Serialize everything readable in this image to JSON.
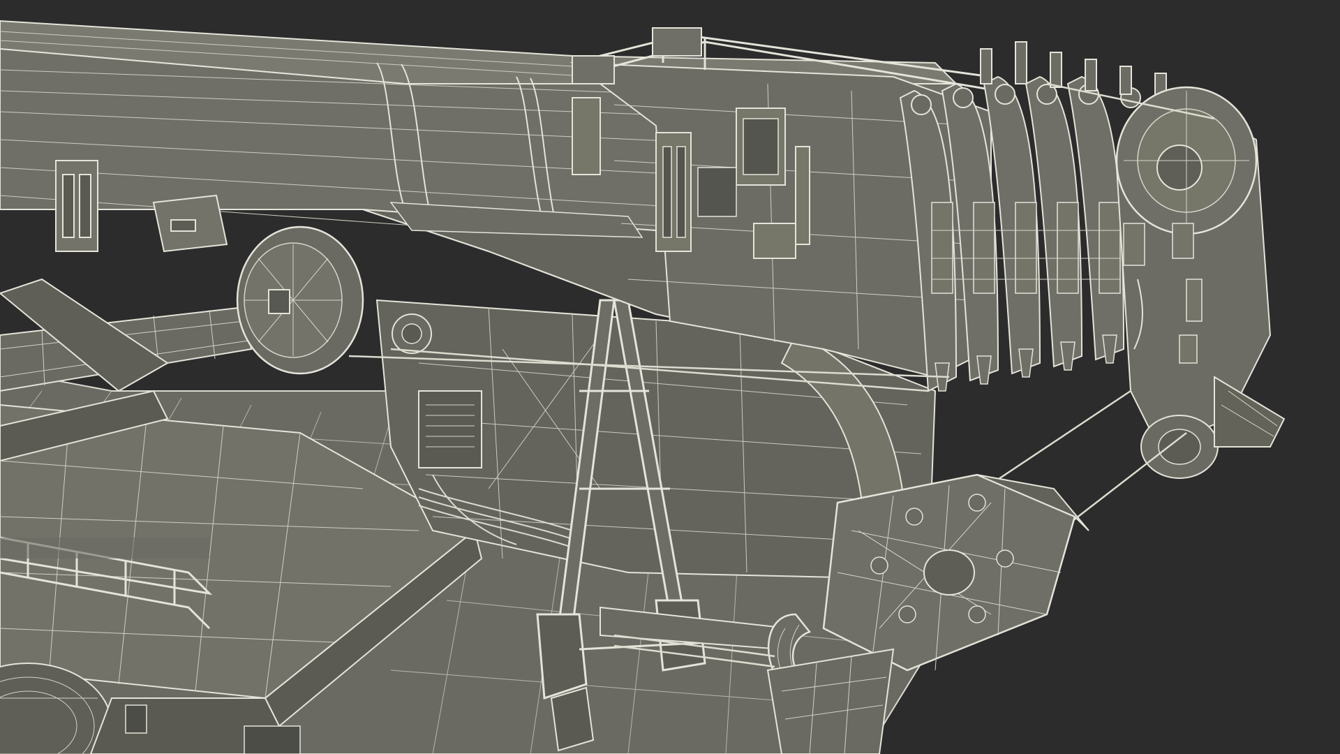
{
  "scene": {
    "subject": "crane-boom-wireframe-render",
    "colors": {
      "background": "#2c2c2c",
      "surface": "#6e6e66",
      "surface_light": "#7c7c73",
      "surface_dark": "#55554f",
      "wire": "#e4e4da",
      "wire_dim": "#b9b9ae",
      "shadow": "#3a3a37"
    }
  }
}
